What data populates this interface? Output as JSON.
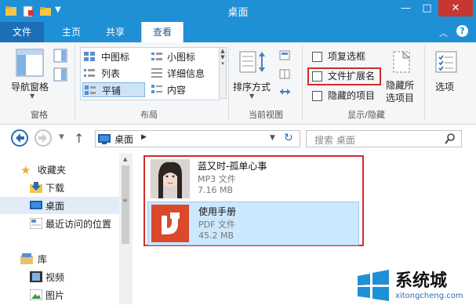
{
  "window": {
    "title": "桌面",
    "minimize_glyph": "—",
    "maximize_glyph": "□",
    "close_glyph": "✕"
  },
  "ribbon_tabs": [
    "文件",
    "主页",
    "共享",
    "查看"
  ],
  "ribbon": {
    "pane_group": {
      "nav_pane_label": "导航窗格",
      "group_label": "窗格"
    },
    "layout_group": {
      "items": [
        "中图标",
        "小图标",
        "列表",
        "详细信息",
        "平铺",
        "内容"
      ],
      "group_label": "布局"
    },
    "current_view_group": {
      "sort_label": "排序方式",
      "group_label": "当前视图"
    },
    "show_hide_group": {
      "checkboxes": [
        "项复选框",
        "文件扩展名",
        "隐藏的项目"
      ],
      "hide_selected_label_1": "隐藏所",
      "hide_selected_label_2": "选项目",
      "group_label": "显示/隐藏"
    },
    "options_label": "选项"
  },
  "address": {
    "path": "桌面",
    "search_placeholder": "搜索 桌面"
  },
  "nav_pane": {
    "items": [
      "收藏夹",
      "下载",
      "桌面",
      "最近访问的位置",
      "库",
      "视频",
      "图片"
    ]
  },
  "files": [
    {
      "name": "蓝又时-孤单心事",
      "type": "MP3 文件",
      "size": "7.16 MB"
    },
    {
      "name": "使用手册",
      "type": "PDF 文件",
      "size": "45.2 MB"
    }
  ],
  "watermark": {
    "brand": "系统城",
    "url": "xitongcheng.com"
  },
  "colors": {
    "titlebar": "#1f8fd6",
    "close_button": "#c7372f",
    "highlight_box": "#d22c2c",
    "selection": "#cce8ff",
    "pdf_icon": "#d9492a"
  }
}
